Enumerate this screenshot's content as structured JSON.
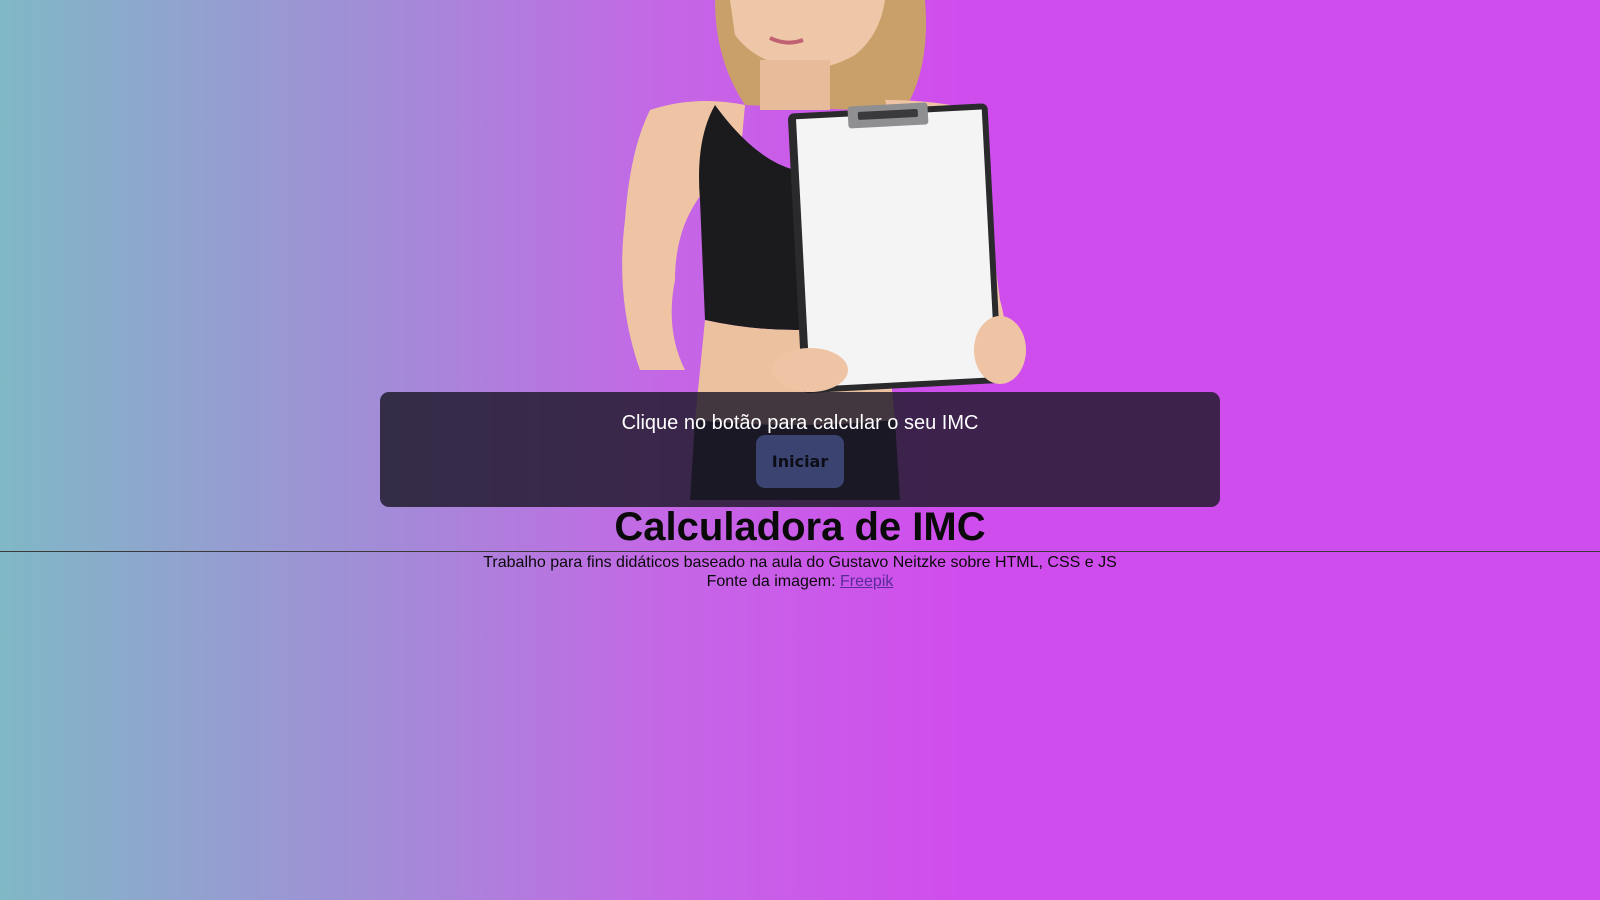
{
  "hero": {
    "image_alt": "Mulher segurando uma prancheta"
  },
  "prompt": {
    "text": "Clique no botão para calcular o seu IMC",
    "button_label": "Iniciar"
  },
  "title": "Calculadora de IMC",
  "footer": {
    "description": "Trabalho para fins didáticos baseado na aula do Gustavo Neitzke sobre HTML, CSS e JS",
    "source_prefix": "Fonte da imagem: ",
    "source_link": "Freepik"
  },
  "colors": {
    "gradient_start": "#80b8c6",
    "gradient_end": "#d04ded",
    "panel": "#1c1828",
    "button": "#3b4470"
  }
}
